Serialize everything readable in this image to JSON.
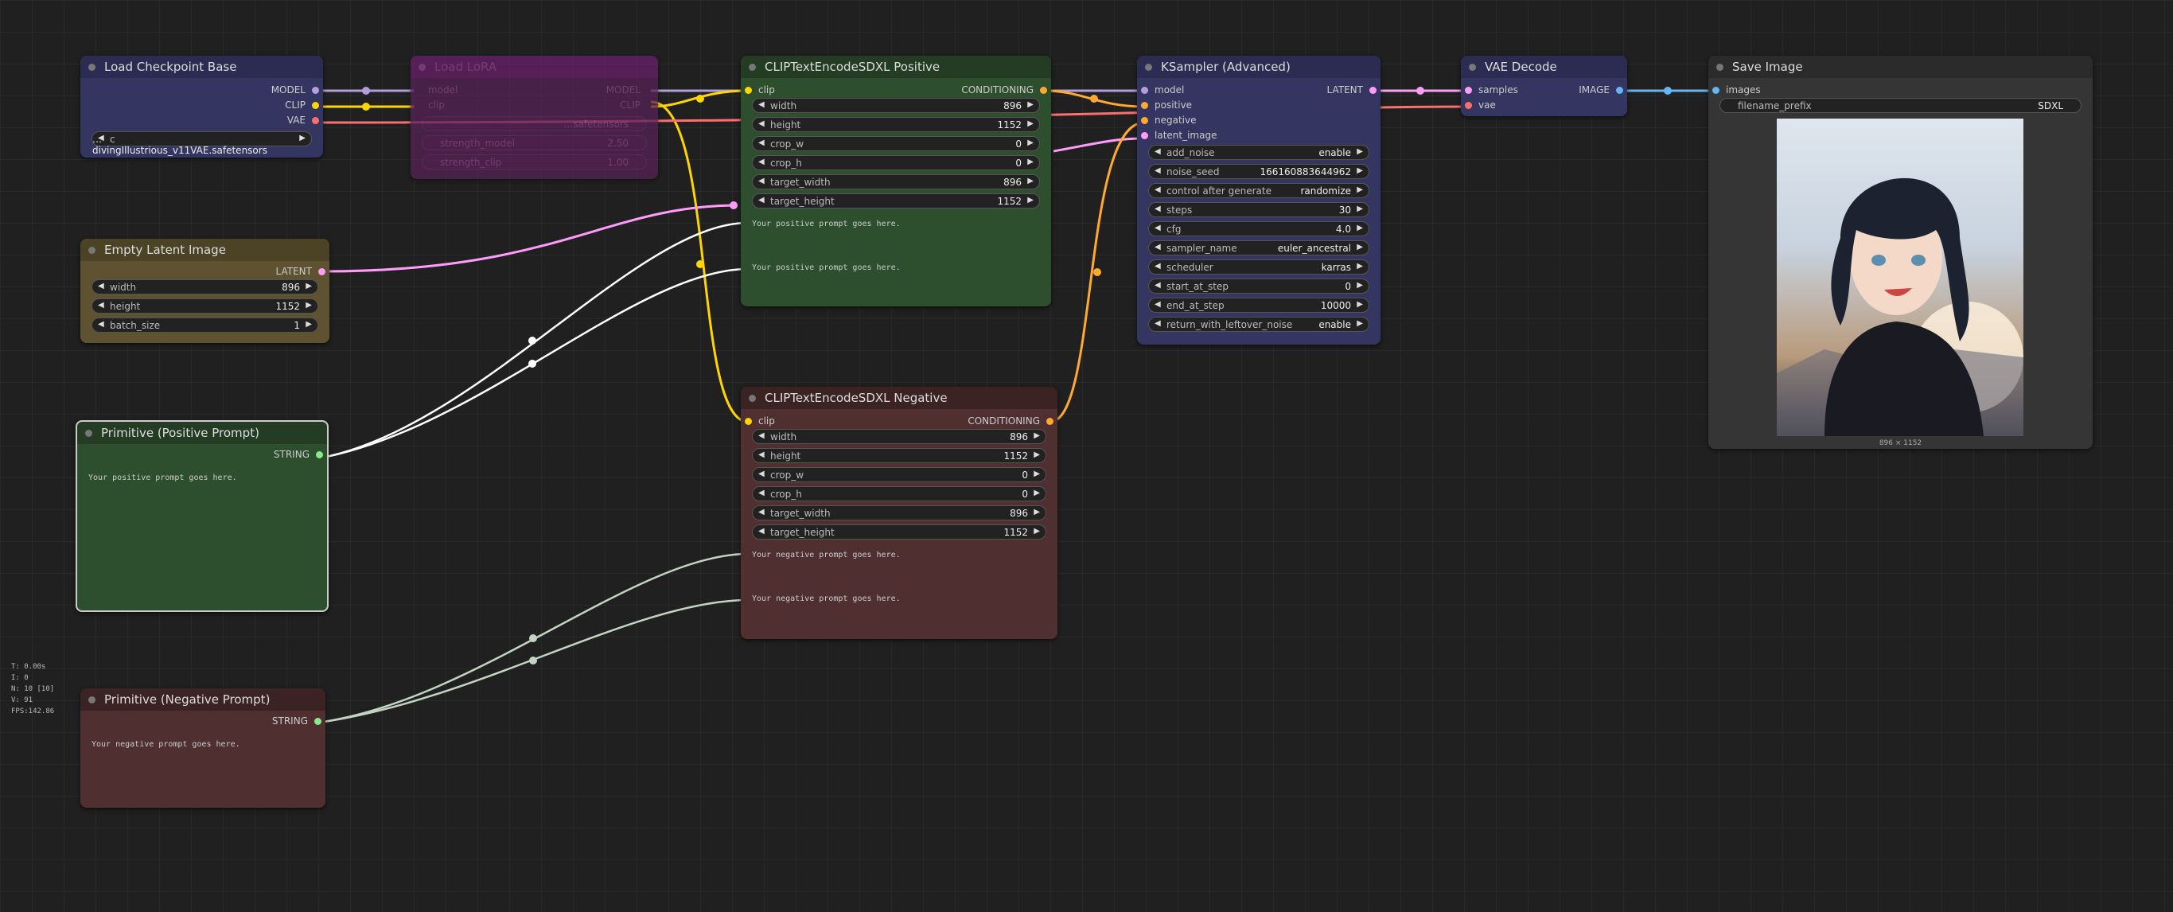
{
  "nodes": {
    "load_checkpoint": {
      "title": "Load Checkpoint Base",
      "outputs": [
        "MODEL",
        "CLIP",
        "VAE"
      ],
      "ckpt_name_prefix": "c",
      "ckpt_name": "… divingIllustrious_v11VAE.safetensors"
    },
    "load_lora": {
      "title": "Load LoRA",
      "inputs": [
        "model",
        "clip"
      ],
      "outputs": [
        "MODEL",
        "CLIP"
      ],
      "lora_name": "…safetensors",
      "strength_model_label": "strength_model",
      "strength_model": "2.50",
      "strength_clip_label": "strength_clip",
      "strength_clip": "1.00"
    },
    "empty_latent": {
      "title": "Empty Latent Image",
      "output": "LATENT",
      "widgets": [
        {
          "label": "width",
          "value": "896"
        },
        {
          "label": "height",
          "value": "1152"
        },
        {
          "label": "batch_size",
          "value": "1"
        }
      ]
    },
    "prim_pos": {
      "title": "Primitive (Positive Prompt)",
      "output": "STRING",
      "text": "Your positive prompt goes here."
    },
    "prim_neg": {
      "title": "Primitive (Negative Prompt)",
      "output": "STRING",
      "text": "Your negative prompt goes here."
    },
    "clip_pos": {
      "title": "CLIPTextEncodeSDXL Positive",
      "input": "clip",
      "output": "CONDITIONING",
      "widgets": [
        {
          "label": "width",
          "value": "896"
        },
        {
          "label": "height",
          "value": "1152"
        },
        {
          "label": "crop_w",
          "value": "0"
        },
        {
          "label": "crop_h",
          "value": "0"
        },
        {
          "label": "target_width",
          "value": "896"
        },
        {
          "label": "target_height",
          "value": "1152"
        }
      ],
      "text_g": "Your positive prompt goes here.",
      "text_l": "Your positive prompt goes here."
    },
    "clip_neg": {
      "title": "CLIPTextEncodeSDXL Negative",
      "input": "clip",
      "output": "CONDITIONING",
      "widgets": [
        {
          "label": "width",
          "value": "896"
        },
        {
          "label": "height",
          "value": "1152"
        },
        {
          "label": "crop_w",
          "value": "0"
        },
        {
          "label": "crop_h",
          "value": "0"
        },
        {
          "label": "target_width",
          "value": "896"
        },
        {
          "label": "target_height",
          "value": "1152"
        }
      ],
      "text_g": "Your negative prompt goes here.",
      "text_l": "Your negative prompt goes here."
    },
    "ksampler": {
      "title": "KSampler (Advanced)",
      "inputs": [
        "model",
        "positive",
        "negative",
        "latent_image"
      ],
      "output": "LATENT",
      "widgets": [
        {
          "label": "add_noise",
          "value": "enable"
        },
        {
          "label": "noise_seed",
          "value": "166160883644962"
        },
        {
          "label": "control after generate",
          "value": "randomize"
        },
        {
          "label": "steps",
          "value": "30"
        },
        {
          "label": "cfg",
          "value": "4.0"
        },
        {
          "label": "sampler_name",
          "value": "euler_ancestral"
        },
        {
          "label": "scheduler",
          "value": "karras"
        },
        {
          "label": "start_at_step",
          "value": "0"
        },
        {
          "label": "end_at_step",
          "value": "10000"
        },
        {
          "label": "return_with_leftover_noise",
          "value": "enable"
        }
      ]
    },
    "vae_decode": {
      "title": "VAE Decode",
      "inputs": [
        "samples",
        "vae"
      ],
      "output": "IMAGE"
    },
    "save_image": {
      "title": "Save Image",
      "input": "images",
      "filename_prefix_label": "filename_prefix",
      "filename_prefix": "SDXL",
      "image_size": "896 × 1152"
    }
  },
  "stats": [
    "T: 0.00s",
    "I: 0",
    "N: 10 [10]",
    "V: 91",
    "FPS:142.86"
  ],
  "colors": {
    "model": "#b39ddb",
    "clip": "#ffd500",
    "vae": "#ff6e6e",
    "latent": "#ff9cf9",
    "conditioning": "#ffa931",
    "image": "#64b5f6",
    "string": "#ffffff"
  }
}
